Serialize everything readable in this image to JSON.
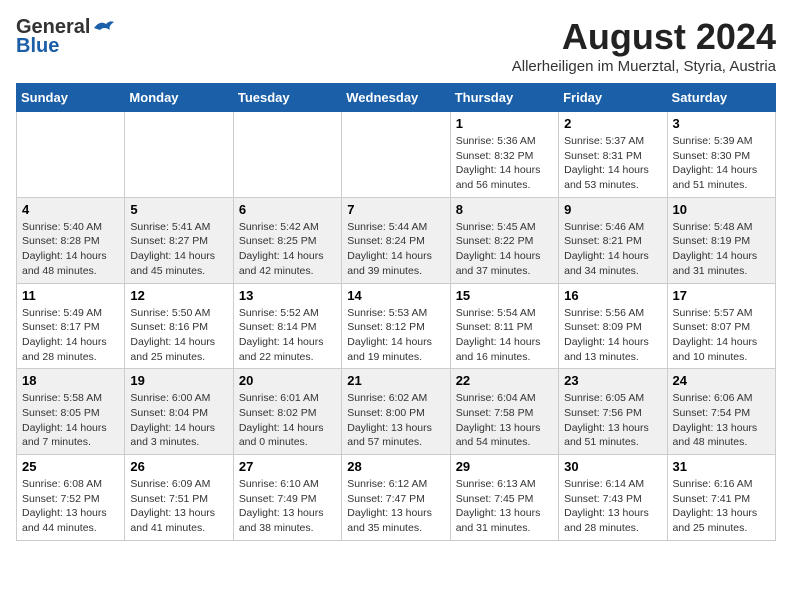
{
  "header": {
    "logo_general": "General",
    "logo_blue": "Blue",
    "month_year": "August 2024",
    "location": "Allerheiligen im Muerztal, Styria, Austria"
  },
  "weekdays": [
    "Sunday",
    "Monday",
    "Tuesday",
    "Wednesday",
    "Thursday",
    "Friday",
    "Saturday"
  ],
  "weeks": [
    [
      {
        "day": "",
        "info": ""
      },
      {
        "day": "",
        "info": ""
      },
      {
        "day": "",
        "info": ""
      },
      {
        "day": "",
        "info": ""
      },
      {
        "day": "1",
        "info": "Sunrise: 5:36 AM\nSunset: 8:32 PM\nDaylight: 14 hours\nand 56 minutes."
      },
      {
        "day": "2",
        "info": "Sunrise: 5:37 AM\nSunset: 8:31 PM\nDaylight: 14 hours\nand 53 minutes."
      },
      {
        "day": "3",
        "info": "Sunrise: 5:39 AM\nSunset: 8:30 PM\nDaylight: 14 hours\nand 51 minutes."
      }
    ],
    [
      {
        "day": "4",
        "info": "Sunrise: 5:40 AM\nSunset: 8:28 PM\nDaylight: 14 hours\nand 48 minutes."
      },
      {
        "day": "5",
        "info": "Sunrise: 5:41 AM\nSunset: 8:27 PM\nDaylight: 14 hours\nand 45 minutes."
      },
      {
        "day": "6",
        "info": "Sunrise: 5:42 AM\nSunset: 8:25 PM\nDaylight: 14 hours\nand 42 minutes."
      },
      {
        "day": "7",
        "info": "Sunrise: 5:44 AM\nSunset: 8:24 PM\nDaylight: 14 hours\nand 39 minutes."
      },
      {
        "day": "8",
        "info": "Sunrise: 5:45 AM\nSunset: 8:22 PM\nDaylight: 14 hours\nand 37 minutes."
      },
      {
        "day": "9",
        "info": "Sunrise: 5:46 AM\nSunset: 8:21 PM\nDaylight: 14 hours\nand 34 minutes."
      },
      {
        "day": "10",
        "info": "Sunrise: 5:48 AM\nSunset: 8:19 PM\nDaylight: 14 hours\nand 31 minutes."
      }
    ],
    [
      {
        "day": "11",
        "info": "Sunrise: 5:49 AM\nSunset: 8:17 PM\nDaylight: 14 hours\nand 28 minutes."
      },
      {
        "day": "12",
        "info": "Sunrise: 5:50 AM\nSunset: 8:16 PM\nDaylight: 14 hours\nand 25 minutes."
      },
      {
        "day": "13",
        "info": "Sunrise: 5:52 AM\nSunset: 8:14 PM\nDaylight: 14 hours\nand 22 minutes."
      },
      {
        "day": "14",
        "info": "Sunrise: 5:53 AM\nSunset: 8:12 PM\nDaylight: 14 hours\nand 19 minutes."
      },
      {
        "day": "15",
        "info": "Sunrise: 5:54 AM\nSunset: 8:11 PM\nDaylight: 14 hours\nand 16 minutes."
      },
      {
        "day": "16",
        "info": "Sunrise: 5:56 AM\nSunset: 8:09 PM\nDaylight: 14 hours\nand 13 minutes."
      },
      {
        "day": "17",
        "info": "Sunrise: 5:57 AM\nSunset: 8:07 PM\nDaylight: 14 hours\nand 10 minutes."
      }
    ],
    [
      {
        "day": "18",
        "info": "Sunrise: 5:58 AM\nSunset: 8:05 PM\nDaylight: 14 hours\nand 7 minutes."
      },
      {
        "day": "19",
        "info": "Sunrise: 6:00 AM\nSunset: 8:04 PM\nDaylight: 14 hours\nand 3 minutes."
      },
      {
        "day": "20",
        "info": "Sunrise: 6:01 AM\nSunset: 8:02 PM\nDaylight: 14 hours\nand 0 minutes."
      },
      {
        "day": "21",
        "info": "Sunrise: 6:02 AM\nSunset: 8:00 PM\nDaylight: 13 hours\nand 57 minutes."
      },
      {
        "day": "22",
        "info": "Sunrise: 6:04 AM\nSunset: 7:58 PM\nDaylight: 13 hours\nand 54 minutes."
      },
      {
        "day": "23",
        "info": "Sunrise: 6:05 AM\nSunset: 7:56 PM\nDaylight: 13 hours\nand 51 minutes."
      },
      {
        "day": "24",
        "info": "Sunrise: 6:06 AM\nSunset: 7:54 PM\nDaylight: 13 hours\nand 48 minutes."
      }
    ],
    [
      {
        "day": "25",
        "info": "Sunrise: 6:08 AM\nSunset: 7:52 PM\nDaylight: 13 hours\nand 44 minutes."
      },
      {
        "day": "26",
        "info": "Sunrise: 6:09 AM\nSunset: 7:51 PM\nDaylight: 13 hours\nand 41 minutes."
      },
      {
        "day": "27",
        "info": "Sunrise: 6:10 AM\nSunset: 7:49 PM\nDaylight: 13 hours\nand 38 minutes."
      },
      {
        "day": "28",
        "info": "Sunrise: 6:12 AM\nSunset: 7:47 PM\nDaylight: 13 hours\nand 35 minutes."
      },
      {
        "day": "29",
        "info": "Sunrise: 6:13 AM\nSunset: 7:45 PM\nDaylight: 13 hours\nand 31 minutes."
      },
      {
        "day": "30",
        "info": "Sunrise: 6:14 AM\nSunset: 7:43 PM\nDaylight: 13 hours\nand 28 minutes."
      },
      {
        "day": "31",
        "info": "Sunrise: 6:16 AM\nSunset: 7:41 PM\nDaylight: 13 hours\nand 25 minutes."
      }
    ]
  ]
}
